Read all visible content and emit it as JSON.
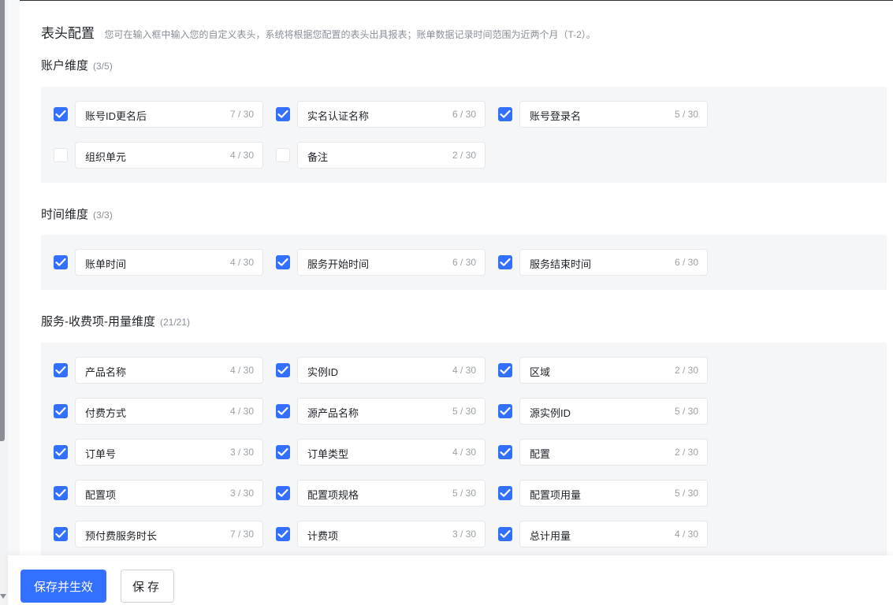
{
  "header": {
    "title": "表头配置",
    "desc": "您可在输入框中输入您的自定义表头，系统将根据您配置的表头出具报表；账单数据记录时间范围为近两个月（T-2）。"
  },
  "sections": [
    {
      "title": "账户维度",
      "count": "(3/5)",
      "items": [
        {
          "label": "账号ID更名后",
          "counter": "7 / 30",
          "checked": true
        },
        {
          "label": "实名认证名称",
          "counter": "6 / 30",
          "checked": true
        },
        {
          "label": "账号登录名",
          "counter": "5 / 30",
          "checked": true
        },
        {
          "label": "组织单元",
          "counter": "4 / 30",
          "checked": false
        },
        {
          "label": "备注",
          "counter": "2 / 30",
          "checked": false
        }
      ]
    },
    {
      "title": "时间维度",
      "count": "(3/3)",
      "items": [
        {
          "label": "账单时间",
          "counter": "4 / 30",
          "checked": true
        },
        {
          "label": "服务开始时间",
          "counter": "6 / 30",
          "checked": true
        },
        {
          "label": "服务结束时间",
          "counter": "6 / 30",
          "checked": true
        }
      ]
    },
    {
      "title": "服务-收费项-用量维度",
      "count": "(21/21)",
      "items": [
        {
          "label": "产品名称",
          "counter": "4 / 30",
          "checked": true
        },
        {
          "label": "实例ID",
          "counter": "4 / 30",
          "checked": true
        },
        {
          "label": "区域",
          "counter": "2 / 30",
          "checked": true
        },
        {
          "label": "付费方式",
          "counter": "4 / 30",
          "checked": true
        },
        {
          "label": "源产品名称",
          "counter": "5 / 30",
          "checked": true
        },
        {
          "label": "源实例ID",
          "counter": "5 / 30",
          "checked": true
        },
        {
          "label": "订单号",
          "counter": "3 / 30",
          "checked": true
        },
        {
          "label": "订单类型",
          "counter": "4 / 30",
          "checked": true
        },
        {
          "label": "配置",
          "counter": "2 / 30",
          "checked": true
        },
        {
          "label": "配置项",
          "counter": "3 / 30",
          "checked": true
        },
        {
          "label": "配置项规格",
          "counter": "5 / 30",
          "checked": true
        },
        {
          "label": "配置项用量",
          "counter": "5 / 30",
          "checked": true
        },
        {
          "label": "预付费服务时长",
          "counter": "7 / 30",
          "checked": true
        },
        {
          "label": "计费项",
          "counter": "3 / 30",
          "checked": true
        },
        {
          "label": "总计用量",
          "counter": "4 / 30",
          "checked": true
        }
      ]
    }
  ],
  "footer": {
    "save_apply_label": "保存并生效",
    "save_label": "保存"
  },
  "colors": {
    "primary": "#3370ff",
    "group_bg": "#f5f6f8"
  }
}
